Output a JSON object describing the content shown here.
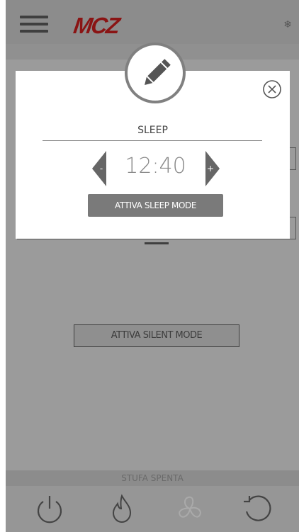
{
  "header": {
    "logo_text": "MCZ",
    "snowflake_glyph": "❄"
  },
  "main": {
    "silent_mode_label": "ATTIVA SILENT MODE"
  },
  "status": {
    "text": "STUFA SPENTA"
  },
  "bottom_nav": {
    "icons": [
      "power-icon",
      "flame-icon",
      "fan-icon",
      "refresh-icon"
    ]
  },
  "modal": {
    "title": "SLEEP",
    "time": "12:40",
    "decrement_glyph": "-",
    "increment_glyph": "+",
    "sleep_mode_label": "ATTIVA SLEEP MODE"
  },
  "colors": {
    "brand": "#8a1414",
    "overlay": "#9b9b9b",
    "button": "#7a7a7a"
  }
}
